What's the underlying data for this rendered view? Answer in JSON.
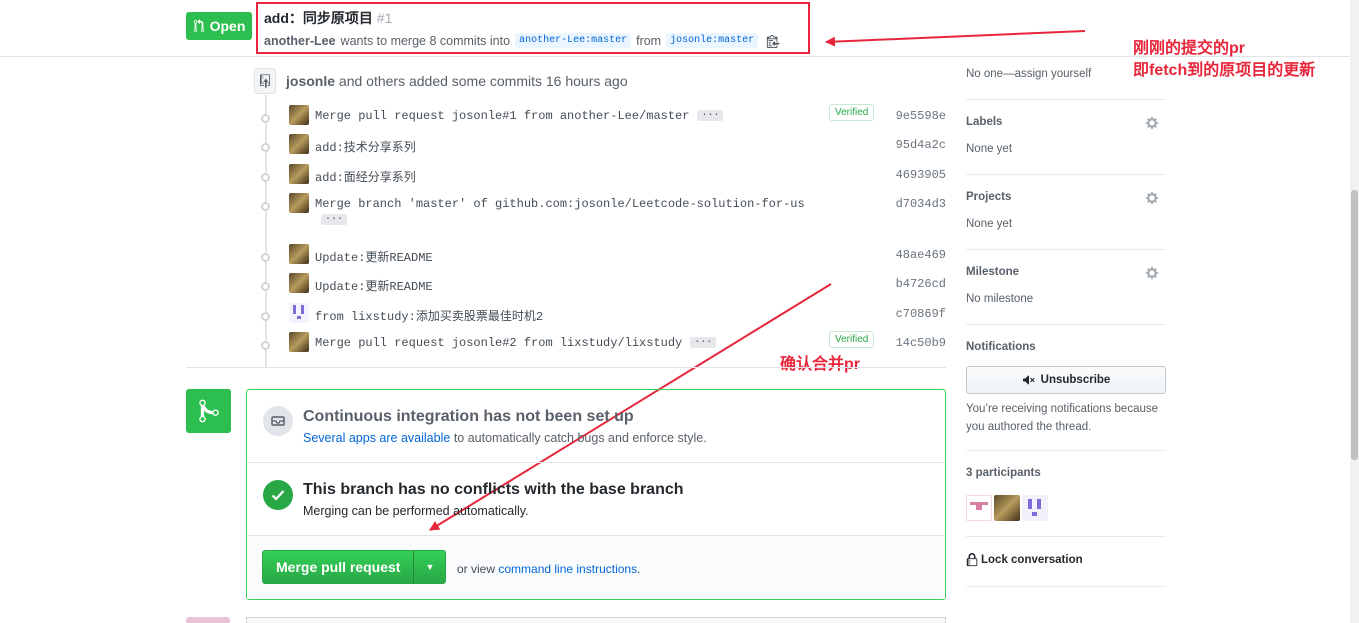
{
  "pr": {
    "state": "Open",
    "title": "add：同步原项目",
    "number": "#1",
    "author": "another-Lee",
    "meta_text": "wants to merge 8 commits into",
    "base_branch": "another-Lee:master",
    "from_text": "from",
    "head_branch": "josonle:master"
  },
  "annotations": {
    "note1_line1": "刚刚的提交的pr",
    "note1_line2": "即fetch到的原项目的更新",
    "note2": "确认合并pr",
    "color": "#e8263b"
  },
  "commits_header": {
    "author": "josonle",
    "text": "and others added some commits 16 hours ago"
  },
  "commits": [
    {
      "message": "Merge pull request josonle#1 from another-Lee/master",
      "more": true,
      "verified": "Verified",
      "sha": "9e5598e",
      "avatar": "photo"
    },
    {
      "message": "add:技术分享系列",
      "more": false,
      "verified": "",
      "sha": "95d4a2c",
      "avatar": "photo"
    },
    {
      "message": "add:面经分享系列",
      "more": false,
      "verified": "",
      "sha": "4693905",
      "avatar": "photo"
    },
    {
      "message": "Merge branch 'master' of github.com:josonle/Leetcode-solution-for-us",
      "more": true,
      "verified": "",
      "sha": "d7034d3",
      "avatar": "photo"
    },
    {
      "message": "Update:更新README",
      "more": false,
      "verified": "",
      "sha": "48ae469",
      "avatar": "photo"
    },
    {
      "message": "Update:更新README",
      "more": false,
      "verified": "",
      "sha": "b4726cd",
      "avatar": "photo"
    },
    {
      "message": "from lixstudy:添加买卖股票最佳时机2",
      "more": false,
      "verified": "",
      "sha": "c70869f",
      "avatar": "identicon"
    },
    {
      "message": "Merge pull request josonle#2 from lixstudy/lixstudy",
      "more": true,
      "verified": "Verified",
      "sha": "14c50b9",
      "avatar": "photo"
    }
  ],
  "more_label": "···",
  "merge": {
    "ci_title": "Continuous integration has not been set up",
    "ci_link": "Several apps are available",
    "ci_rest": "to automatically catch bugs and enforce style.",
    "nc_title": "This branch has no conflicts with the base branch",
    "nc_sub": "Merging can be performed automatically.",
    "button_label": "Merge pull request",
    "view_prefix": "or view",
    "view_link": "command line instructions",
    "view_suffix": "."
  },
  "sidebar": {
    "assignees_value": "No one—assign yourself",
    "labels_head": "Labels",
    "labels_value": "None yet",
    "projects_head": "Projects",
    "projects_value": "None yet",
    "milestone_head": "Milestone",
    "milestone_value": "No milestone",
    "notifications_head": "Notifications",
    "unsubscribe_label": "Unsubscribe",
    "notif_text": "You’re receiving notifications because you authored the thread.",
    "participants_head": "3 participants",
    "lock_label": "Lock conversation"
  },
  "colors": {
    "green": "#2cbe4e",
    "link": "#0366d6",
    "annotation_red": "#e8263b"
  }
}
